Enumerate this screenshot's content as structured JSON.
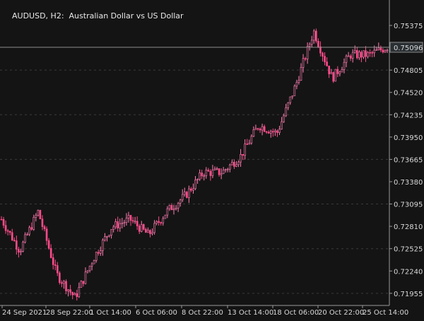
{
  "window": {
    "symbol_timeframe": "AUDUSD, H2:",
    "description": "Australian Dollar vs US Dollar"
  },
  "colors": {
    "background": "#141414",
    "grid": "#3a3a3a",
    "axis": "#9a9a9a",
    "bull": "#ff7fb3",
    "bear": "#ff4c8b",
    "current_price_line": "#8c8c8c",
    "current_price_box_bg": "#2a2f33"
  },
  "chart_data": {
    "type": "candlestick",
    "title": "AUDUSD, H2:  Australian Dollar vs US Dollar",
    "ylim": [
      0.718,
      0.757
    ],
    "y_ticks": [
      0.71955,
      0.7224,
      0.72525,
      0.7281,
      0.73095,
      0.7338,
      0.73665,
      0.7395,
      0.74235,
      0.7452,
      0.74805,
      0.75096,
      0.75375
    ],
    "y_tick_labels": [
      "0.71955",
      "0.72240",
      "0.72525",
      "0.72810",
      "0.73095",
      "0.73380",
      "0.73665",
      "0.73950",
      "0.74235",
      "0.74520",
      "0.74805",
      "0.75096",
      "0.75375"
    ],
    "x_tick_labels": [
      "24 Sep 2021",
      "28 Sep 22:00",
      "1 Oct 14:00",
      "6 Oct 06:00",
      "8 Oct 22:00",
      "13 Oct 14:00",
      "18 Oct 06:00",
      "20 Oct 22:00",
      "25 Oct 14:00"
    ],
    "current_price": 0.75096,
    "approx_path": [
      {
        "x": "24 Sep 2021",
        "y": 0.729
      },
      {
        "x": "25 Sep",
        "y": 0.725
      },
      {
        "x": "27 Sep",
        "y": 0.73
      },
      {
        "x": "28 Sep 22:00",
        "y": 0.722
      },
      {
        "x": "29 Sep",
        "y": 0.719
      },
      {
        "x": "30 Sep",
        "y": 0.724
      },
      {
        "x": "1 Oct 14:00",
        "y": 0.728
      },
      {
        "x": "4 Oct",
        "y": 0.729
      },
      {
        "x": "6 Oct 06:00",
        "y": 0.727
      },
      {
        "x": "7 Oct",
        "y": 0.73
      },
      {
        "x": "8 Oct 22:00",
        "y": 0.732
      },
      {
        "x": "11 Oct",
        "y": 0.735
      },
      {
        "x": "12 Oct",
        "y": 0.735
      },
      {
        "x": "13 Oct 14:00",
        "y": 0.737
      },
      {
        "x": "14 Oct",
        "y": 0.741
      },
      {
        "x": "18 Oct 06:00",
        "y": 0.74
      },
      {
        "x": "19 Oct",
        "y": 0.746
      },
      {
        "x": "20 Oct 22:00",
        "y": 0.753
      },
      {
        "x": "21 Oct",
        "y": 0.747
      },
      {
        "x": "22 Oct",
        "y": 0.75
      },
      {
        "x": "25 Oct 14:00",
        "y": 0.75
      },
      {
        "x": "26 Oct",
        "y": 0.751
      }
    ]
  }
}
